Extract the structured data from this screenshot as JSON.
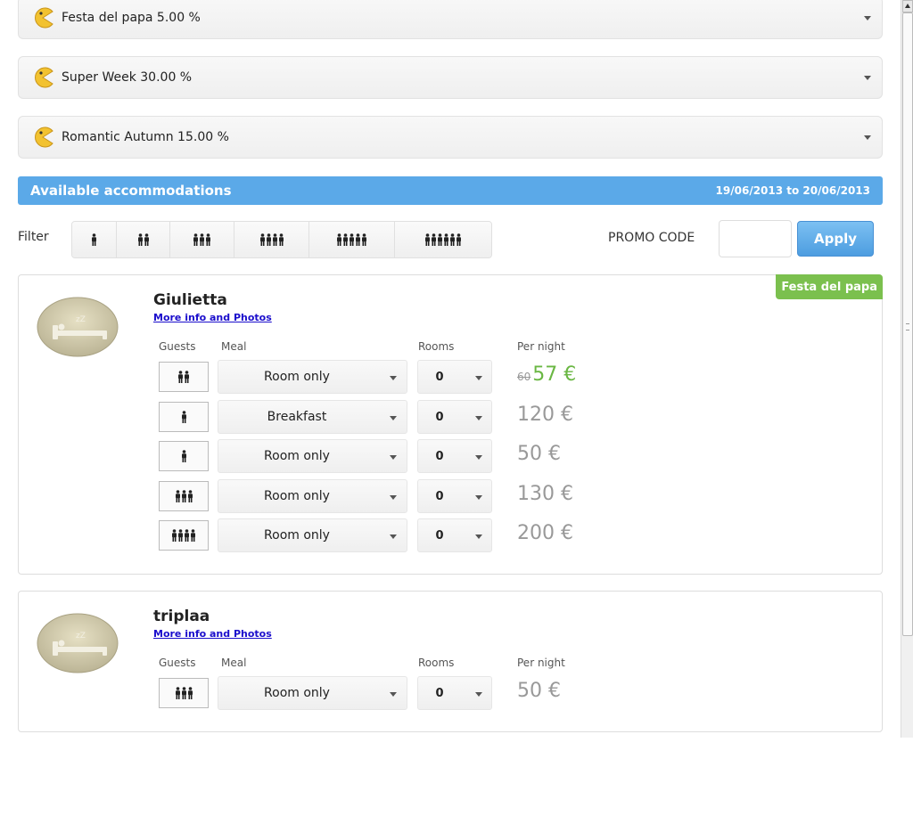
{
  "promos": [
    {
      "label": "Festa del papa 5.00 %",
      "icon": "pacman-icon"
    },
    {
      "label": "Super Week 30.00 %",
      "icon": "pacman-icon"
    },
    {
      "label": "Romantic Autumn 15.00 %",
      "icon": "pacman-icon"
    }
  ],
  "availability": {
    "title": "Available accommodations",
    "dates": "19/06/2013 to 20/06/2013"
  },
  "filter": {
    "label": "Filter",
    "options": [
      1,
      2,
      3,
      4,
      5,
      6
    ]
  },
  "promo_code": {
    "label": "PROMO CODE",
    "value": "",
    "apply_label": "Apply"
  },
  "columns": {
    "guests": "Guests",
    "meal": "Meal",
    "rooms": "Rooms",
    "per_night": "Per night"
  },
  "accommodations": [
    {
      "name": "Giulietta",
      "more_info": "More info and Photos",
      "badge": "Festa del papa",
      "rows": [
        {
          "guests": 2,
          "meal": "Room only",
          "rooms": "0",
          "old_price": "60",
          "price": "57 €",
          "promo": true
        },
        {
          "guests": 1,
          "meal": "Breakfast",
          "rooms": "0",
          "old_price": "",
          "price": "120 €",
          "promo": false
        },
        {
          "guests": 1,
          "meal": "Room only",
          "rooms": "0",
          "old_price": "",
          "price": "50 €",
          "promo": false
        },
        {
          "guests": 3,
          "meal": "Room only",
          "rooms": "0",
          "old_price": "",
          "price": "130 €",
          "promo": false
        },
        {
          "guests": 4,
          "meal": "Room only",
          "rooms": "0",
          "old_price": "",
          "price": "200 €",
          "promo": false
        }
      ]
    },
    {
      "name": "triplaa",
      "more_info": "More info and Photos",
      "badge": "",
      "rows": [
        {
          "guests": 3,
          "meal": "Room only",
          "rooms": "0",
          "old_price": "",
          "price": "50 €",
          "promo": false
        }
      ]
    }
  ],
  "colors": {
    "header_blue": "#5ba9e8",
    "promo_green": "#7bc04e",
    "price_green": "#6ab743",
    "link_blue": "#1a0dcc"
  }
}
